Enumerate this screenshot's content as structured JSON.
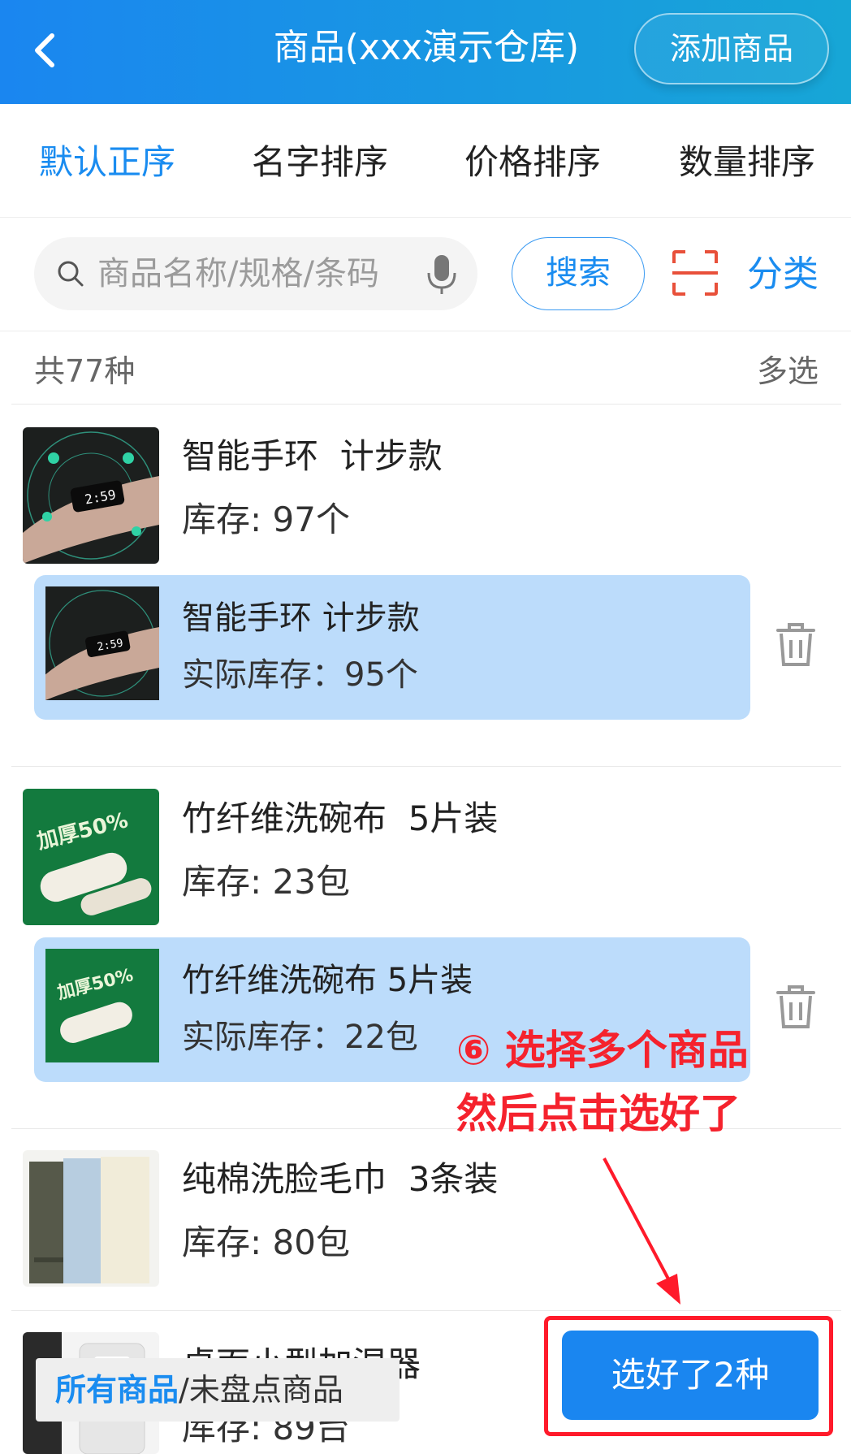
{
  "header": {
    "title": "商品(xxx演示仓库)",
    "add_label": "添加商品",
    "back_icon": "chevron-left-icon"
  },
  "sort_tabs": [
    {
      "label": "默认正序",
      "active": true
    },
    {
      "label": "名字排序",
      "active": false
    },
    {
      "label": "价格排序",
      "active": false
    },
    {
      "label": "数量排序",
      "active": false
    }
  ],
  "search": {
    "placeholder": "商品名称/规格/条码",
    "button_label": "搜索",
    "category_label": "分类",
    "scan_icon": "scan-icon",
    "mic_icon": "microphone-icon"
  },
  "summary": {
    "count": "共77种",
    "multi_select": "多选"
  },
  "products": [
    {
      "name": "智能手环  计步款",
      "stock": "库存: 97个",
      "selected_name": "智能手环 计步款",
      "actual_stock": "实际库存：95个"
    },
    {
      "name": "竹纤维洗碗布  5片装",
      "stock": "库存: 23包",
      "selected_name": "竹纤维洗碗布 5片装",
      "actual_stock": "实际库存：22包"
    },
    {
      "name": "纯棉洗脸毛巾  3条装",
      "stock": "库存: 80包"
    },
    {
      "name": "桌面小型加湿器",
      "stock": "库存: 89台"
    }
  ],
  "annotation": {
    "line1": "⑥ 选择多个商品",
    "line2": "然后点击选好了"
  },
  "bottom": {
    "filter_active": "所有商品",
    "filter_rest": "/未盘点商品",
    "confirm_label": "选好了2种"
  },
  "colors": {
    "primary": "#1a86f0",
    "selected_bg": "#bcdcfb",
    "annotation_red": "#ff1a2a"
  }
}
